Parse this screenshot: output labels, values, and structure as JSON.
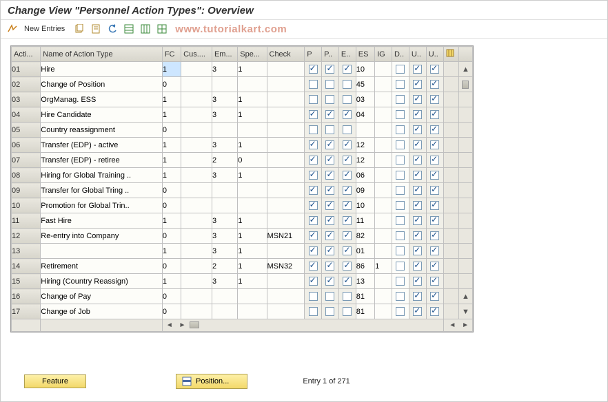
{
  "title": "Change View \"Personnel Action Types\": Overview",
  "toolbar": {
    "new_entries": "New Entries"
  },
  "watermark": "www.tutorialkart.com",
  "columns": [
    "Acti...",
    "Name of Action Type",
    "FC",
    "Cus....",
    "Em...",
    "Spe...",
    "Check",
    "P",
    "P..",
    "E..",
    "ES",
    "IG",
    "D..",
    "U..",
    "U.."
  ],
  "rows": [
    {
      "a": "01",
      "n": "Hire",
      "fc": "1",
      "cus": "",
      "em": "3",
      "spe": "1",
      "chk": "",
      "p1": true,
      "p2": true,
      "e": true,
      "es": "10",
      "ig": "",
      "d": false,
      "u1": true,
      "u2": true,
      "sel": true
    },
    {
      "a": "02",
      "n": "Change of Position",
      "fc": "0",
      "cus": "",
      "em": "",
      "spe": "",
      "chk": "",
      "p1": false,
      "p2": false,
      "e": false,
      "es": "45",
      "ig": "",
      "d": false,
      "u1": true,
      "u2": true
    },
    {
      "a": "03",
      "n": "OrgManag. ESS",
      "fc": "1",
      "cus": "",
      "em": "3",
      "spe": "1",
      "chk": "",
      "p1": false,
      "p2": false,
      "e": false,
      "es": "03",
      "ig": "",
      "d": false,
      "u1": true,
      "u2": true
    },
    {
      "a": "04",
      "n": "Hire Candidate",
      "fc": "1",
      "cus": "",
      "em": "3",
      "spe": "1",
      "chk": "",
      "p1": true,
      "p2": true,
      "e": true,
      "es": "04",
      "ig": "",
      "d": false,
      "u1": true,
      "u2": true
    },
    {
      "a": "05",
      "n": "Country reassignment",
      "fc": "0",
      "cus": "",
      "em": "",
      "spe": "",
      "chk": "",
      "p1": false,
      "p2": false,
      "e": false,
      "es": "",
      "ig": "",
      "d": false,
      "u1": true,
      "u2": true
    },
    {
      "a": "06",
      "n": "Transfer (EDP) - active",
      "fc": "1",
      "cus": "",
      "em": "3",
      "spe": "1",
      "chk": "",
      "p1": true,
      "p2": true,
      "e": true,
      "es": "12",
      "ig": "",
      "d": false,
      "u1": true,
      "u2": true
    },
    {
      "a": "07",
      "n": "Transfer (EDP) - retiree",
      "fc": "1",
      "cus": "",
      "em": "2",
      "spe": "0",
      "chk": "",
      "p1": true,
      "p2": true,
      "e": true,
      "es": "12",
      "ig": "",
      "d": false,
      "u1": true,
      "u2": true
    },
    {
      "a": "08",
      "n": "Hiring for Global Training ..",
      "fc": "1",
      "cus": "",
      "em": "3",
      "spe": "1",
      "chk": "",
      "p1": true,
      "p2": true,
      "e": true,
      "es": "06",
      "ig": "",
      "d": false,
      "u1": true,
      "u2": true
    },
    {
      "a": "09",
      "n": "Transfer for Global Tring ..",
      "fc": "0",
      "cus": "",
      "em": "",
      "spe": "",
      "chk": "",
      "p1": true,
      "p2": true,
      "e": true,
      "es": "09",
      "ig": "",
      "d": false,
      "u1": true,
      "u2": true
    },
    {
      "a": "10",
      "n": "Promotion for Global Trin..",
      "fc": "0",
      "cus": "",
      "em": "",
      "spe": "",
      "chk": "",
      "p1": true,
      "p2": true,
      "e": true,
      "es": "10",
      "ig": "",
      "d": false,
      "u1": true,
      "u2": true
    },
    {
      "a": "11",
      "n": "Fast Hire",
      "fc": "1",
      "cus": "",
      "em": "3",
      "spe": "1",
      "chk": "",
      "p1": true,
      "p2": true,
      "e": true,
      "es": "11",
      "ig": "",
      "d": false,
      "u1": true,
      "u2": true
    },
    {
      "a": "12",
      "n": "Re-entry into Company",
      "fc": "0",
      "cus": "",
      "em": "3",
      "spe": "1",
      "chk": "MSN21",
      "p1": true,
      "p2": true,
      "e": true,
      "es": "82",
      "ig": "",
      "d": false,
      "u1": true,
      "u2": true
    },
    {
      "a": "13",
      "n": "",
      "fc": "1",
      "cus": "",
      "em": "3",
      "spe": "1",
      "chk": "",
      "p1": true,
      "p2": true,
      "e": true,
      "es": "01",
      "ig": "",
      "d": false,
      "u1": true,
      "u2": true
    },
    {
      "a": "14",
      "n": "Retirement",
      "fc": "0",
      "cus": "",
      "em": "2",
      "spe": "1",
      "chk": "MSN32",
      "p1": true,
      "p2": true,
      "e": true,
      "es": "86",
      "ig": "1",
      "d": false,
      "u1": true,
      "u2": true
    },
    {
      "a": "15",
      "n": "Hiring (Country Reassign)",
      "fc": "1",
      "cus": "",
      "em": "3",
      "spe": "1",
      "chk": "",
      "p1": true,
      "p2": true,
      "e": true,
      "es": "13",
      "ig": "",
      "d": false,
      "u1": true,
      "u2": true
    },
    {
      "a": "16",
      "n": "Change of Pay",
      "fc": "0",
      "cus": "",
      "em": "",
      "spe": "",
      "chk": "",
      "p1": false,
      "p2": false,
      "e": false,
      "es": "81",
      "ig": "",
      "d": false,
      "u1": true,
      "u2": true
    },
    {
      "a": "17",
      "n": "Change of Job",
      "fc": "0",
      "cus": "",
      "em": "",
      "spe": "",
      "chk": "",
      "p1": false,
      "p2": false,
      "e": false,
      "es": "81",
      "ig": "",
      "d": false,
      "u1": true,
      "u2": true
    }
  ],
  "footer": {
    "feature": "Feature",
    "position": "Position...",
    "entry": "Entry 1 of 271"
  }
}
